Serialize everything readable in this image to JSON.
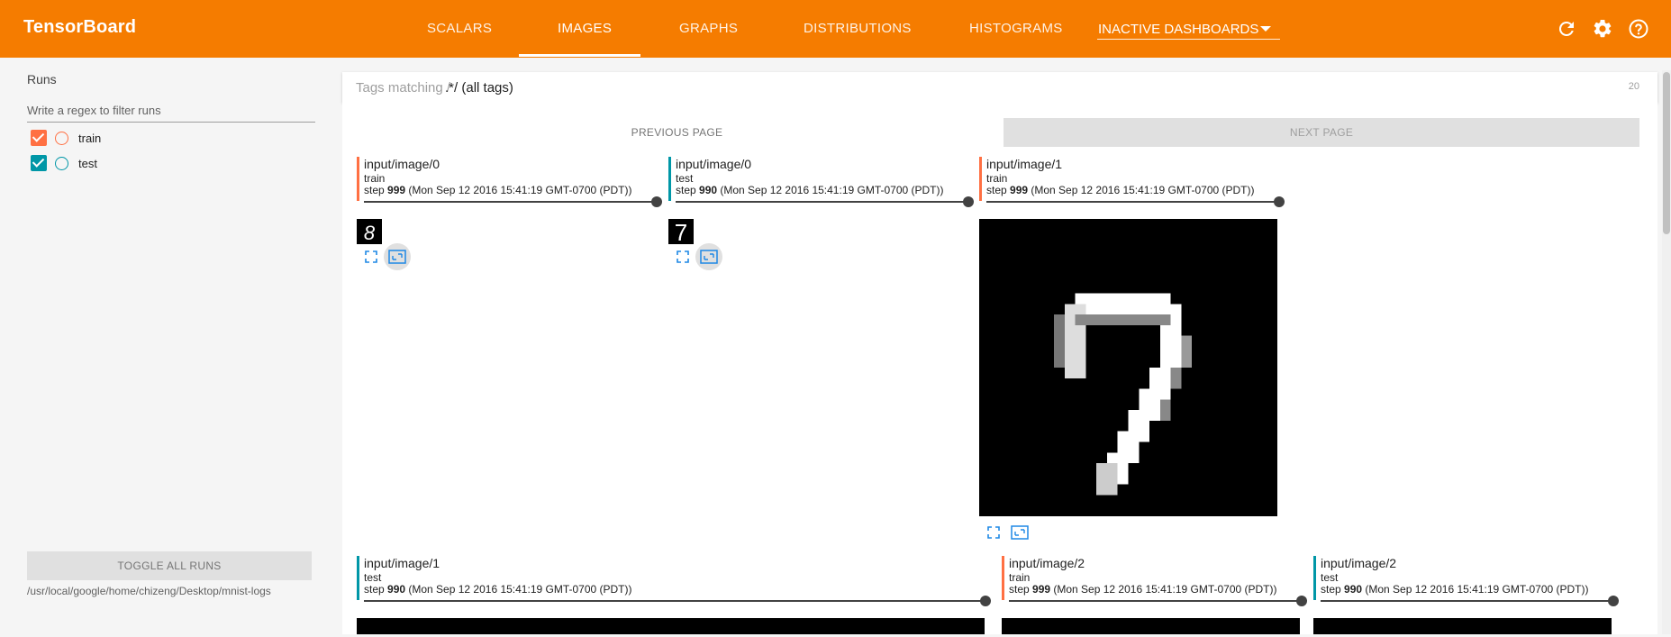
{
  "header": {
    "brand": "TensorBoard",
    "tabs": [
      {
        "label": "SCALARS",
        "active": false
      },
      {
        "label": "IMAGES",
        "active": true
      },
      {
        "label": "GRAPHS",
        "active": false
      },
      {
        "label": "DISTRIBUTIONS",
        "active": false
      },
      {
        "label": "HISTOGRAMS",
        "active": false
      }
    ],
    "inactive_dashboards": "INACTIVE DASHBOARDS",
    "icons": [
      "refresh-icon",
      "settings-icon",
      "help-icon"
    ],
    "color": "#f57c00"
  },
  "sidebar": {
    "runs_title": "Runs",
    "filter_placeholder": "Write a regex to filter runs",
    "runs": [
      {
        "name": "train",
        "checked": true,
        "color": "#ff7043"
      },
      {
        "name": "test",
        "checked": true,
        "color": "#0097a7"
      }
    ],
    "toggle_all": "TOGGLE ALL RUNS",
    "logdir": "/usr/local/google/home/chizeng/Desktop/mnist-logs"
  },
  "main": {
    "search": {
      "label": "Tags matching /",
      "pattern": ".*/",
      "suffix": "(all tags)",
      "count": "20"
    },
    "pagination": {
      "previous": "PREVIOUS PAGE",
      "next": "NEXT PAGE"
    },
    "cards": [
      {
        "tag": "input/image/0",
        "run": "train",
        "step_prefix": "step ",
        "step": "999",
        "time": " (Mon Sep 12 2016 15:41:19 GMT-0700 (PDT))",
        "color": "#ff7043",
        "digit": "8"
      },
      {
        "tag": "input/image/0",
        "run": "test",
        "step_prefix": "step ",
        "step": "990",
        "time": " (Mon Sep 12 2016 15:41:19 GMT-0700 (PDT))",
        "color": "#0097a7",
        "digit": "7"
      },
      {
        "tag": "input/image/1",
        "run": "train",
        "step_prefix": "step ",
        "step": "999",
        "time": " (Mon Sep 12 2016 15:41:19 GMT-0700 (PDT))",
        "color": "#ff7043",
        "digit": "7"
      },
      {
        "tag": "input/image/1",
        "run": "test",
        "step_prefix": "step ",
        "step": "990",
        "time": " (Mon Sep 12 2016 15:41:19 GMT-0700 (PDT))",
        "color": "#0097a7"
      },
      {
        "tag": "input/image/2",
        "run": "train",
        "step_prefix": "step ",
        "step": "999",
        "time": " (Mon Sep 12 2016 15:41:19 GMT-0700 (PDT))",
        "color": "#ff7043"
      },
      {
        "tag": "input/image/2",
        "run": "test",
        "step_prefix": "step ",
        "step": "990",
        "time": " (Mon Sep 12 2016 15:41:19 GMT-0700 (PDT))",
        "color": "#0097a7"
      }
    ]
  }
}
